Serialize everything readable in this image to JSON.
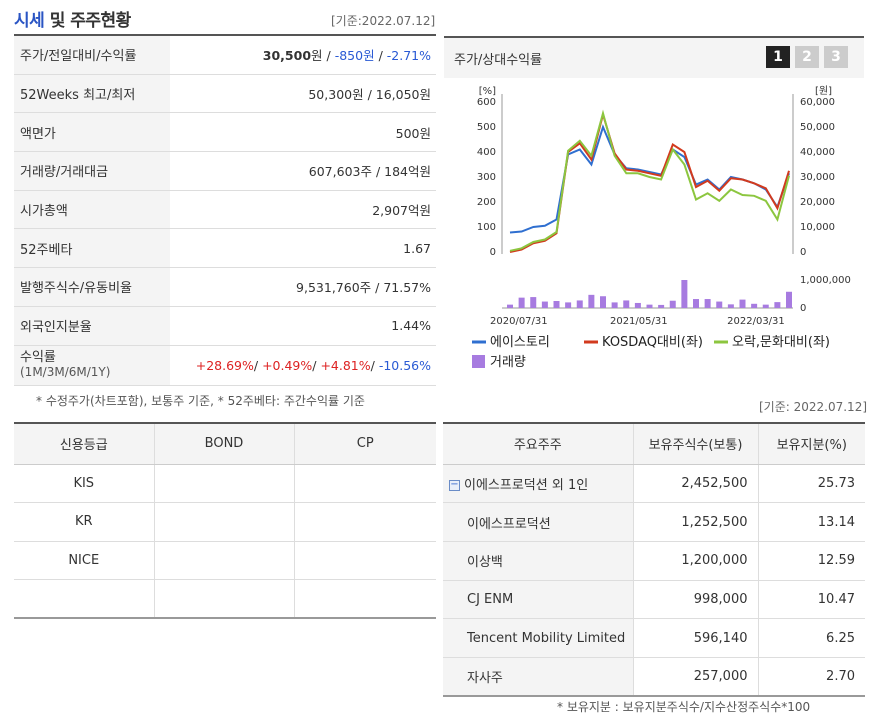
{
  "header": {
    "title_a": "시세",
    "title_b": "및 주주현황",
    "date": "[기준:2022.07.12]"
  },
  "price_table": [
    {
      "label": "52Weeks 최고/최저",
      "value": "50,300원 / 16,050원"
    },
    {
      "label": "액면가",
      "value": "500원"
    },
    {
      "label": "거래량/거래대금",
      "value": "607,603주 / 184억원"
    },
    {
      "label": "시가총액",
      "value": "2,907억원"
    },
    {
      "label": "52주베타",
      "value": "1.67"
    },
    {
      "label": "발행주식수/유동비율",
      "value": "9,531,760주 / 71.57%"
    },
    {
      "label": "외국인지분율",
      "value": "1.44%"
    }
  ],
  "price_row": {
    "label": "주가/전일대비/수익률",
    "price": "30,500",
    "price_unit": "원",
    "sep": " / ",
    "change": "-850원",
    "rate": "-2.71%"
  },
  "return_row": {
    "label": "수익률",
    "sub": "(1M/3M/6M/1Y)",
    "r1": "+28.69%",
    "r2": "+0.49%",
    "r3": "+4.81%",
    "r4": "-10.56%"
  },
  "note1": "* 수정주가(차트포함), 보통주 기준, * 52주베타: 주간수익률 기준",
  "credit": {
    "headers": [
      "신용등급",
      "BOND",
      "CP"
    ],
    "rows": [
      "KIS",
      "KR",
      "NICE",
      ""
    ]
  },
  "chart": {
    "title": "주가/상대수익률",
    "tabs": [
      "1",
      "2",
      "3"
    ],
    "left_unit": "[%]",
    "right_unit": "[원]",
    "left_ticks": [
      "600",
      "500",
      "400",
      "300",
      "200",
      "100",
      "0"
    ],
    "right_ticks": [
      "60,000",
      "50,000",
      "40,000",
      "30,000",
      "20,000",
      "10,000",
      "0"
    ],
    "vol_tick": "1,000,000",
    "vol_zero": "0",
    "x_labels": [
      "2020/07/31",
      "2021/05/31",
      "2022/03/31"
    ],
    "legend": [
      "에이스토리",
      "KOSDAQ대비(좌)",
      "오락,문화대비(좌)",
      "거래량"
    ],
    "colors": {
      "stock": "#2f6fd0",
      "kosdaq": "#d23a1e",
      "culture": "#8cc63f",
      "volume": "#a77be0"
    }
  },
  "chart_data": {
    "type": "line",
    "x": [
      "2020/07/31",
      "",
      "",
      "",
      "",
      "",
      "",
      "",
      "",
      "",
      "",
      "",
      "",
      "",
      "",
      "",
      "",
      "",
      "",
      "",
      "",
      "",
      "",
      "",
      "",
      "",
      "",
      "",
      "",
      "2022/07/12"
    ],
    "series": [
      {
        "name": "에이스토리",
        "axis": "right",
        "values": [
          7800,
          8200,
          10000,
          10500,
          13000,
          39000,
          41000,
          35000,
          50000,
          39000,
          33500,
          33000,
          32000,
          31000,
          41000,
          38000,
          27000,
          29000,
          25000,
          30000,
          29000,
          27500,
          25000,
          18000,
          31500
        ]
      },
      {
        "name": "KOSDAQ대비(좌)",
        "axis": "left",
        "values": [
          0,
          10,
          35,
          45,
          75,
          400,
          435,
          370,
          550,
          395,
          330,
          325,
          315,
          305,
          430,
          400,
          260,
          285,
          245,
          295,
          290,
          275,
          255,
          175,
          325
        ]
      },
      {
        "name": "오락,문화대비(좌)",
        "axis": "left",
        "values": [
          5,
          15,
          40,
          50,
          80,
          405,
          445,
          385,
          555,
          385,
          315,
          315,
          300,
          290,
          410,
          350,
          210,
          235,
          205,
          250,
          228,
          225,
          205,
          130,
          305
        ]
      },
      {
        "name": "거래량",
        "axis": "volume",
        "values": [
          120000,
          370000,
          390000,
          230000,
          250000,
          200000,
          270000,
          470000,
          420000,
          200000,
          270000,
          180000,
          120000,
          110000,
          260000,
          1000000,
          320000,
          320000,
          230000,
          130000,
          300000,
          150000,
          120000,
          210000,
          580000
        ]
      }
    ],
    "ylim_left": [
      0,
      600
    ],
    "ylim_right": [
      0,
      60000
    ],
    "vol_max": 1000000
  },
  "date_right": "[기준: 2022.07.12]",
  "holders": {
    "headers": [
      "주요주주",
      "보유주식수(보통)",
      "보유지분(%)"
    ],
    "group_icon": "−",
    "rows": [
      {
        "name": "이에스프로덕션 외 1인",
        "shares": "2,452,500",
        "pct": "25.73"
      },
      {
        "name": "이에스프로덕션",
        "shares": "1,252,500",
        "pct": "13.14"
      },
      {
        "name": "이상백",
        "shares": "1,200,000",
        "pct": "12.59"
      },
      {
        "name": "CJ ENM",
        "shares": "998,000",
        "pct": "10.47"
      },
      {
        "name": "Tencent Mobility Limited",
        "shares": "596,140",
        "pct": "6.25"
      },
      {
        "name": "자사주",
        "shares": "257,000",
        "pct": "2.70"
      }
    ]
  },
  "note2": "* 보유지분 : 보유지분주식수/지수산정주식수*100"
}
